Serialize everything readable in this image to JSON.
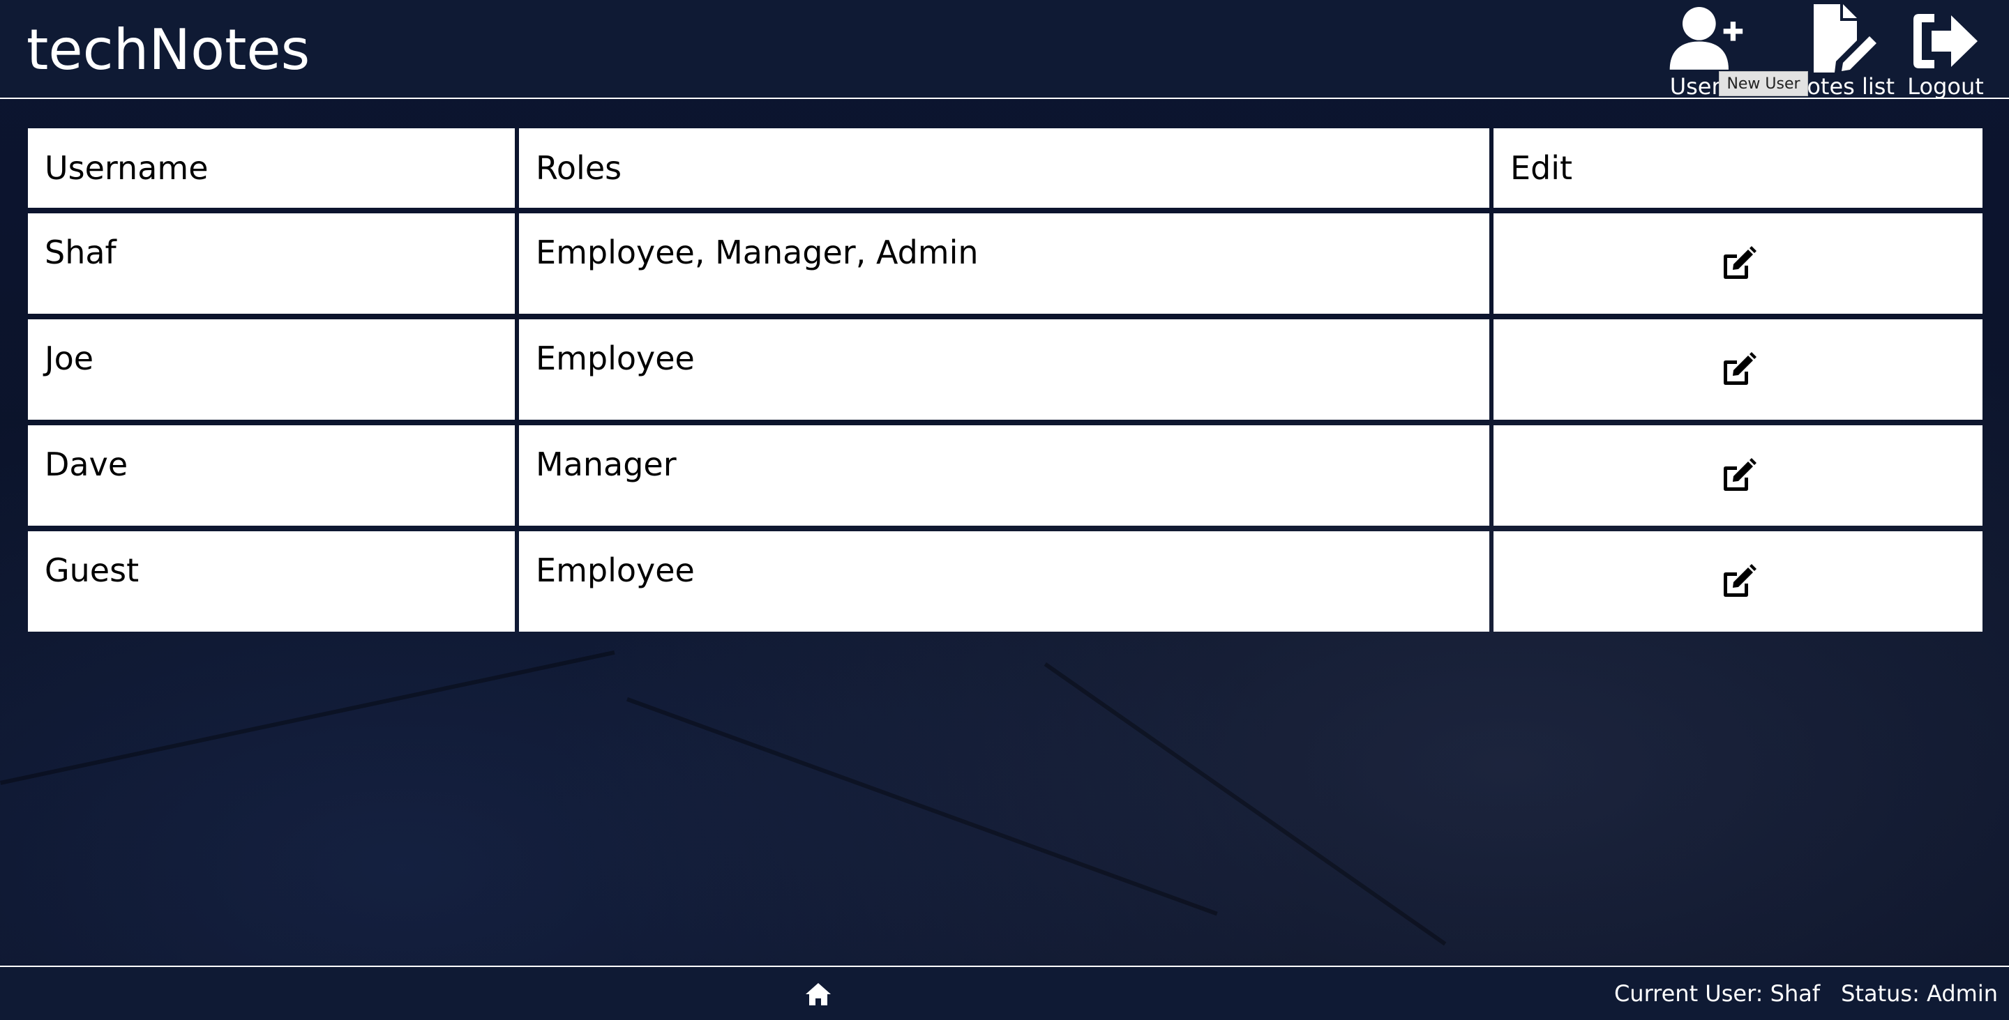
{
  "app": {
    "brand": "techNotes"
  },
  "nav": {
    "new_user_label": "User S",
    "notes_list_label": "Notes list",
    "logout_label": "Logout",
    "tooltip": "New User"
  },
  "table": {
    "headers": [
      "Username",
      "Roles",
      "Edit"
    ],
    "rows": [
      {
        "username": "Shaf",
        "roles": "Employee, Manager, Admin"
      },
      {
        "username": "Joe",
        "roles": "Employee"
      },
      {
        "username": "Dave",
        "roles": "Manager"
      },
      {
        "username": "Guest",
        "roles": "Employee"
      }
    ]
  },
  "footer": {
    "current_user": "Current User: Shaf",
    "status": "Status: Admin"
  },
  "colors": {
    "header_bg": "#0f1a34",
    "page_bg": "#0a1128",
    "cell_bg": "#ffffff",
    "tooltip_bg": "#e2e2e2"
  },
  "icons": {
    "new_user": "user-plus-icon",
    "notes_list": "file-pen-icon",
    "logout": "logout-icon",
    "edit": "pen-to-square-icon",
    "home": "home-icon"
  }
}
